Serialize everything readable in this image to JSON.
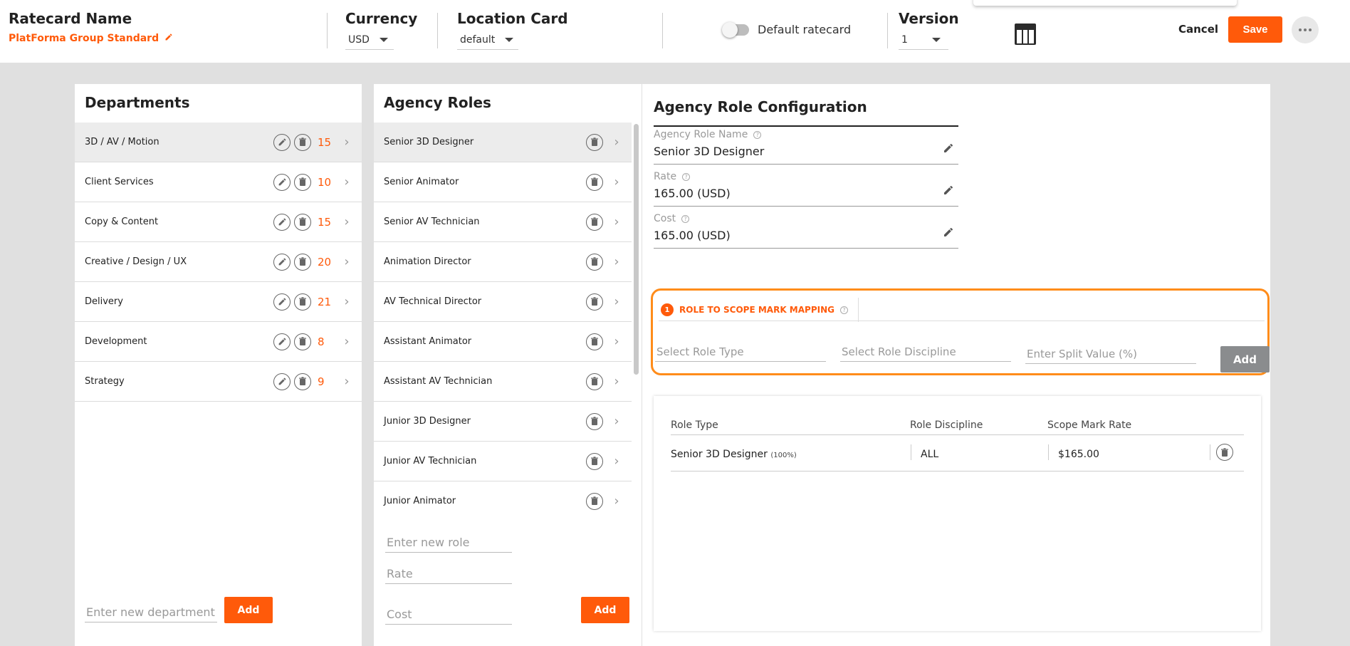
{
  "header": {
    "ratecard_title": "Ratecard Name",
    "ratecard_name": "PlatForma Group Standard",
    "currency_title": "Currency",
    "currency_value": "USD",
    "location_title": "Location Card",
    "location_value": "default",
    "default_toggle_label": "Default ratecard",
    "default_toggle_on": false,
    "version_title": "Version",
    "version_value": "1",
    "cancel_label": "Cancel",
    "save_label": "Save",
    "accent_color": "#ff5a0a"
  },
  "departments": {
    "title": "Departments",
    "items": [
      {
        "label": "3D / AV / Motion",
        "count": "15"
      },
      {
        "label": "Client Services",
        "count": "10"
      },
      {
        "label": "Copy & Content",
        "count": "15"
      },
      {
        "label": "Creative / Design / UX",
        "count": "20"
      },
      {
        "label": "Delivery",
        "count": "21"
      },
      {
        "label": "Development",
        "count": "8"
      },
      {
        "label": "Strategy",
        "count": "9"
      }
    ],
    "new_placeholder": "Enter new department",
    "add_label": "Add"
  },
  "roles": {
    "title": "Agency Roles",
    "items": [
      {
        "label": "Senior 3D Designer"
      },
      {
        "label": "Senior Animator"
      },
      {
        "label": "Senior AV Technician"
      },
      {
        "label": "Animation Director"
      },
      {
        "label": "AV Technical Director"
      },
      {
        "label": "Assistant Animator"
      },
      {
        "label": "Assistant AV Technician"
      },
      {
        "label": "Junior 3D Designer"
      },
      {
        "label": "Junior AV Technician"
      },
      {
        "label": "Junior Animator"
      }
    ],
    "new_role_placeholder": "Enter new role",
    "rate_placeholder": "Rate",
    "cost_placeholder": "Cost",
    "add_label": "Add"
  },
  "config": {
    "title": "Agency Role Configuration",
    "role_name_label": "Agency Role Name",
    "role_name_value": "Senior 3D Designer",
    "rate_label": "Rate",
    "rate_value": "165.00 (USD)",
    "cost_label": "Cost",
    "cost_value": "165.00 (USD)",
    "mapping": {
      "step_number": "1",
      "tab_label": "ROLE TO SCOPE MARK MAPPING",
      "role_type_placeholder": "Select Role Type",
      "role_discipline_placeholder": "Select Role Discipline",
      "split_placeholder": "Enter Split Value (%)",
      "add_label": "Add"
    },
    "table": {
      "columns": [
        "Role Type",
        "Role Discipline",
        "Scope Mark Rate"
      ],
      "rows": [
        {
          "role_type": "Senior 3D Designer",
          "split": "(100%)",
          "discipline": "ALL",
          "rate": "$165.00"
        }
      ]
    }
  }
}
